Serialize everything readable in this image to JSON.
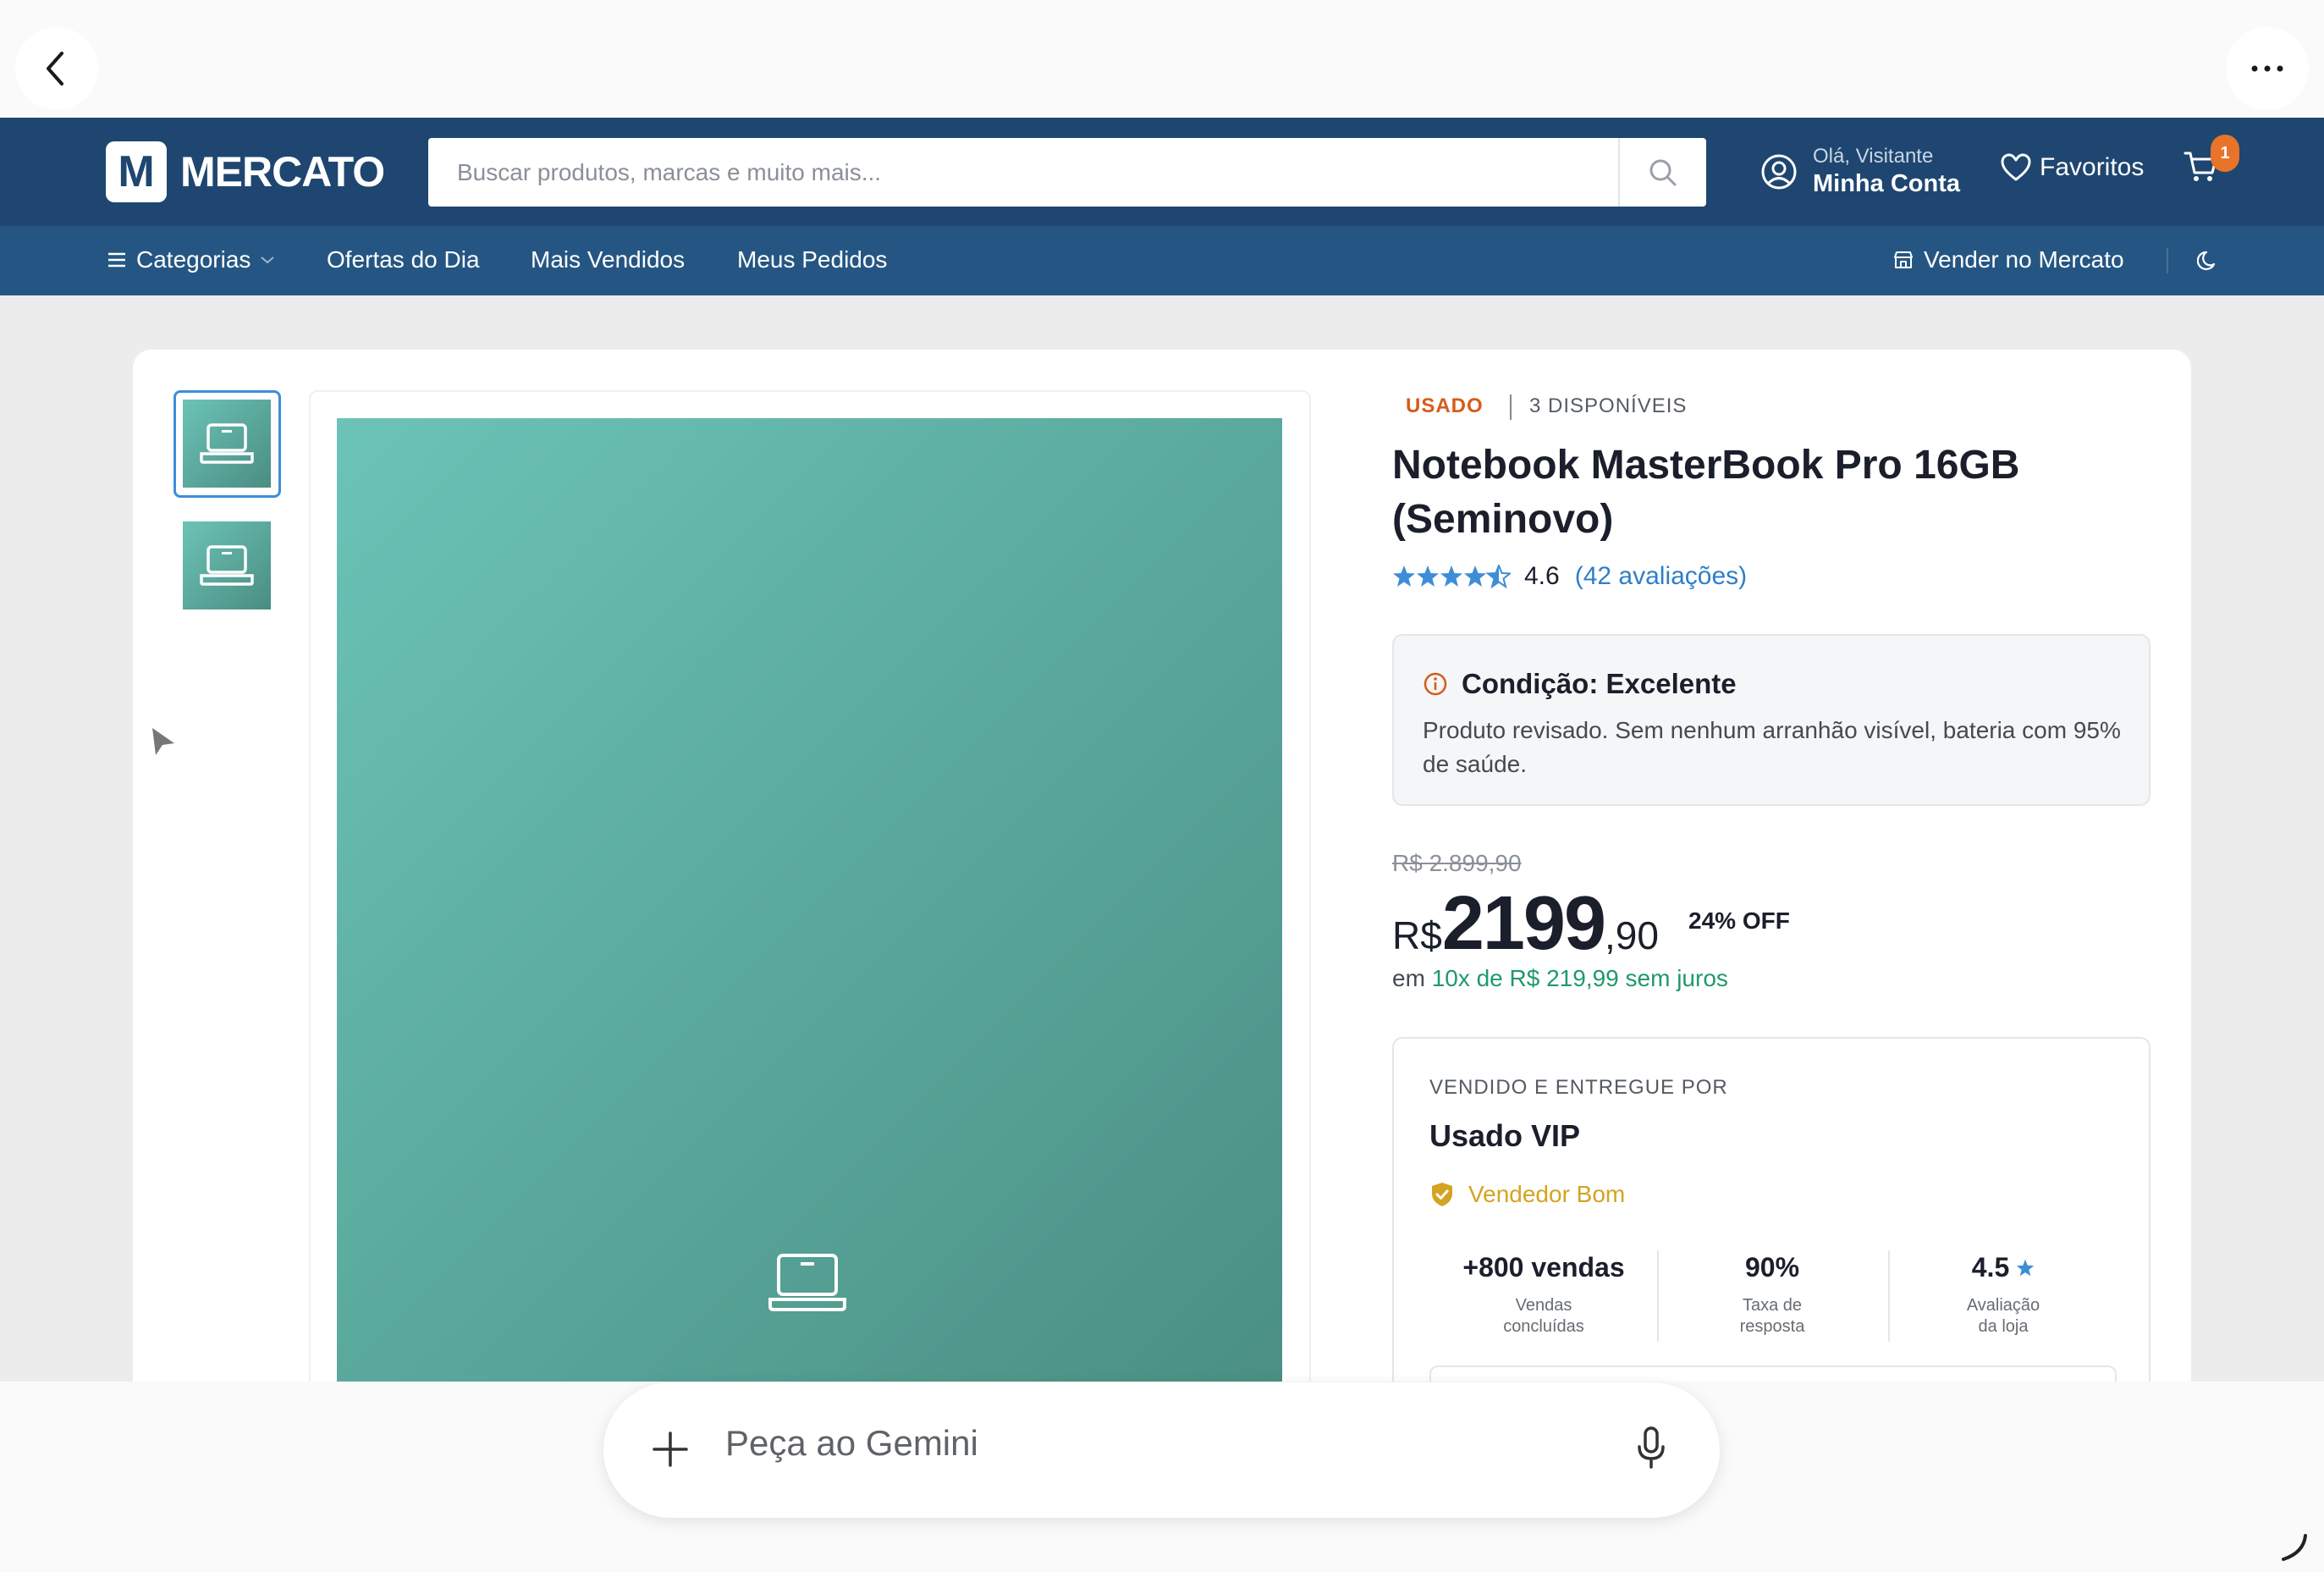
{
  "header": {
    "logo_letter": "M",
    "logo_text": "MERCATO",
    "search_placeholder": "Buscar produtos, marcas e muito mais...",
    "account_greeting": "Olá, Visitante",
    "account_label": "Minha Conta",
    "favorites_label": "Favoritos",
    "cart_count": "1"
  },
  "nav": {
    "categories": "Categorias",
    "items": [
      "Ofertas do Dia",
      "Mais Vendidos",
      "Meus Pedidos"
    ],
    "sell": "Vender no Mercato"
  },
  "product": {
    "condition_badge": "USADO",
    "stock": "3 DISPONÍVEIS",
    "title": "Notebook MasterBook Pro 16GB (Seminovo)",
    "rating": "4.6",
    "rating_stars": 4.5,
    "reviews": "(42 avaliações)",
    "condition_title": "Condição: Excelente",
    "condition_text": "Produto revisado. Sem nenhum arranhão visível, bateria com 95% de saúde.",
    "old_price": "R$ 2.899,90",
    "price_currency": "R$",
    "price_int": "2199",
    "price_cents": ",90",
    "discount": "24% OFF",
    "installments_prefix": "em",
    "installments": "10x de R$ 219,99 sem juros"
  },
  "seller": {
    "label": "VENDIDO E ENTREGUE POR",
    "name": "Usado VIP",
    "tag": "Vendedor Bom",
    "stats": [
      {
        "value": "+800 vendas",
        "label1": "Vendas",
        "label2": "concluídas"
      },
      {
        "value": "90%",
        "label1": "Taxa de",
        "label2": "resposta"
      },
      {
        "value": "4.5",
        "label1": "Avaliação",
        "label2": "da loja"
      }
    ]
  },
  "gemini": {
    "placeholder": "Peça ao Gemini"
  },
  "colors": {
    "header_bg": "#1e4670",
    "nav_bg": "#255683",
    "accent_orange": "#e8742a",
    "star_blue": "#3d8ed6",
    "link_blue": "#2f7ec8",
    "green": "#1f9a6a",
    "gold": "#d4a321",
    "image_teal": "#5aa89c"
  }
}
